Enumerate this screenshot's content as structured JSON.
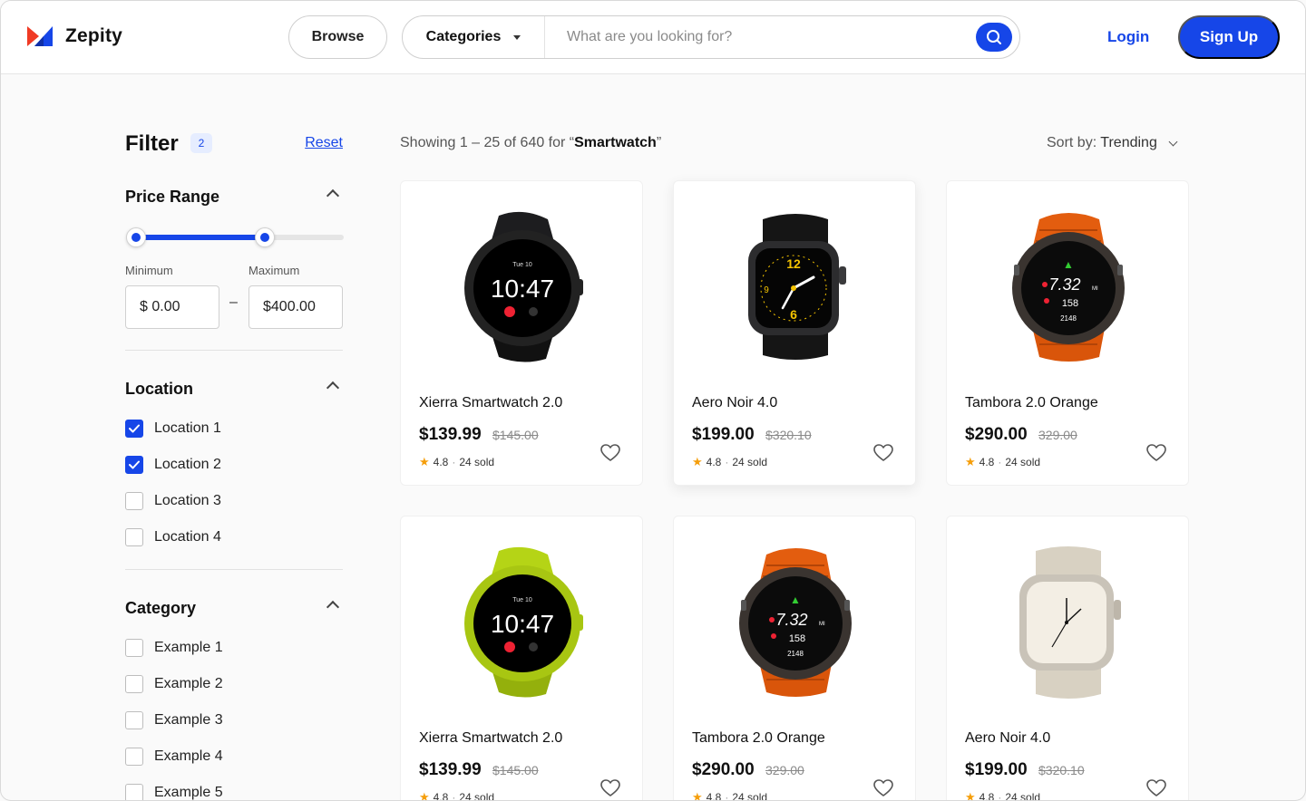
{
  "header": {
    "brand": "Zepity",
    "browse_label": "Browse",
    "categories_label": "Categories",
    "search_placeholder": "What are you looking for?",
    "login_label": "Login",
    "signup_label": "Sign Up"
  },
  "colors": {
    "accent": "#1646e8",
    "logo_red": "#f03a24",
    "star": "#f59e0b"
  },
  "filter": {
    "title": "Filter",
    "count": "2",
    "reset_label": "Reset",
    "price": {
      "title": "Price Range",
      "min_label": "Minimum",
      "max_label": "Maximum",
      "min_value": "$ 0.00",
      "max_value": "$400.00",
      "dash": "–",
      "range_start_fraction": 0,
      "range_end_fraction": 0.62
    },
    "location": {
      "title": "Location",
      "items": [
        {
          "label": "Location 1",
          "checked": true
        },
        {
          "label": "Location 2",
          "checked": true
        },
        {
          "label": "Location 3",
          "checked": false
        },
        {
          "label": "Location 4",
          "checked": false
        }
      ]
    },
    "category": {
      "title": "Category",
      "items": [
        {
          "label": "Example 1",
          "checked": false
        },
        {
          "label": "Example 2",
          "checked": false
        },
        {
          "label": "Example 3",
          "checked": false
        },
        {
          "label": "Example 4",
          "checked": false
        },
        {
          "label": "Example 5",
          "checked": false
        }
      ]
    }
  },
  "results": {
    "prefix": "Showing 1 – 25 of 640 for “",
    "query": "Smartwatch",
    "suffix": "”",
    "sort_label": "Sort by:",
    "sort_value": "Trending"
  },
  "products": [
    {
      "name": "Xierra Smartwatch 2.0",
      "price": "$139.99",
      "old_price": "$145.00",
      "rating": "4.8",
      "sold": "24 sold",
      "watch": "round-black"
    },
    {
      "name": "Aero Noir 4.0",
      "price": "$199.00",
      "old_price": "$320.10",
      "rating": "4.8",
      "sold": "24 sold",
      "watch": "square-black"
    },
    {
      "name": "Tambora 2.0 Orange",
      "price": "$290.00",
      "old_price": "329.00",
      "rating": "4.8",
      "sold": "24 sold",
      "watch": "round-orange"
    },
    {
      "name": "Xierra Smartwatch 2.0",
      "price": "$139.99",
      "old_price": "$145.00",
      "rating": "4.8",
      "sold": "24 sold",
      "watch": "round-lime"
    },
    {
      "name": "Tambora 2.0 Orange",
      "price": "$290.00",
      "old_price": "329.00",
      "rating": "4.8",
      "sold": "24 sold",
      "watch": "round-orange"
    },
    {
      "name": "Aero Noir 4.0",
      "price": "$199.00",
      "old_price": "$320.10",
      "rating": "4.8",
      "sold": "24 sold",
      "watch": "square-cream"
    }
  ],
  "watch_faces": {
    "digital_day": "Tue 10",
    "digital_time": "10:47",
    "sport_distance": "7.32",
    "sport_unit": "MI",
    "sport_hr": "158",
    "sport_elev": "2148"
  }
}
